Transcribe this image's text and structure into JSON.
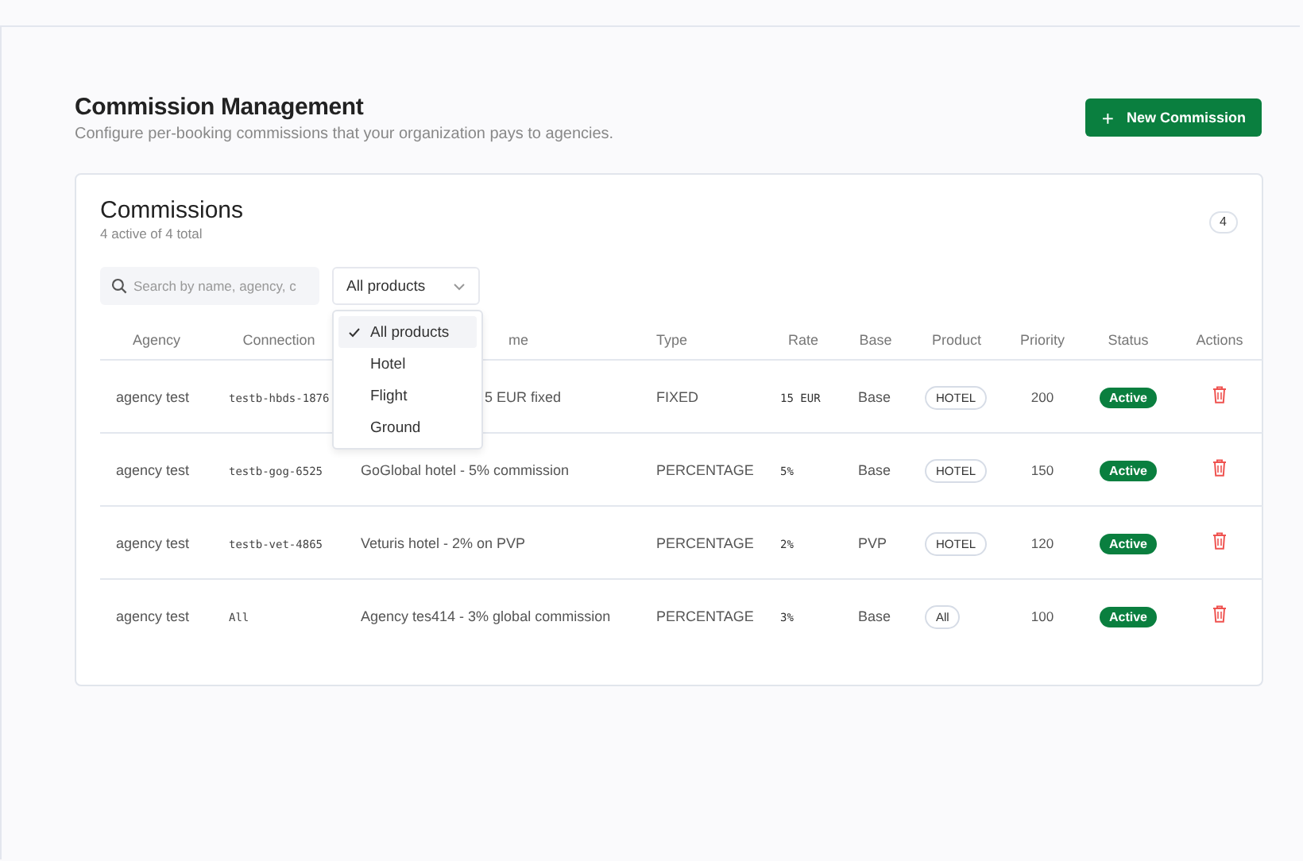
{
  "header": {
    "title": "Commission Management",
    "subtitle": "Configure per-booking commissions that your organization pays to agencies.",
    "new_button": {
      "icon": "+",
      "label": "New Commission"
    }
  },
  "card": {
    "title": "Commissions",
    "subtitle": "4 active of 4 total",
    "count": "4",
    "search": {
      "placeholder": "Search by name, agency, c"
    },
    "product_filter": {
      "value": "All products",
      "expanded": true,
      "options": [
        {
          "label": "All products",
          "selected": true
        },
        {
          "label": "Hotel",
          "selected": false
        },
        {
          "label": "Flight",
          "selected": false
        },
        {
          "label": "Ground",
          "selected": false
        }
      ]
    },
    "table": {
      "columns": [
        {
          "label": "Agency"
        },
        {
          "label": "Connection"
        },
        {
          "label": "me"
        },
        {
          "label": "Type"
        },
        {
          "label": "Rate"
        },
        {
          "label": "Base"
        },
        {
          "label": "Product"
        },
        {
          "label": "Priority"
        },
        {
          "label": "Status"
        },
        {
          "label": "Actions"
        }
      ],
      "rows": [
        {
          "agency": "agency test",
          "connection": "testb-hbds-1876",
          "name": "5 EUR fixed",
          "type": "FIXED",
          "rate": "15 EUR",
          "base": "Base",
          "product": "HOTEL",
          "priority": "200",
          "status": "Active"
        },
        {
          "agency": "agency test",
          "connection": "testb-gog-6525",
          "name": "GoGlobal hotel - 5% commission",
          "type": "PERCENTAGE",
          "rate": "5%",
          "base": "Base",
          "product": "HOTEL",
          "priority": "150",
          "status": "Active"
        },
        {
          "agency": "agency test",
          "connection": "testb-vet-4865",
          "name": "Veturis hotel - 2% on PVP",
          "type": "PERCENTAGE",
          "rate": "2%",
          "base": "PVP",
          "product": "HOTEL",
          "priority": "120",
          "status": "Active"
        },
        {
          "agency": "agency test",
          "connection": "All",
          "name": "Agency tes414 - 3% global commission",
          "type": "PERCENTAGE",
          "rate": "3%",
          "base": "Base",
          "product": "All",
          "priority": "100",
          "status": "Active"
        }
      ]
    }
  }
}
